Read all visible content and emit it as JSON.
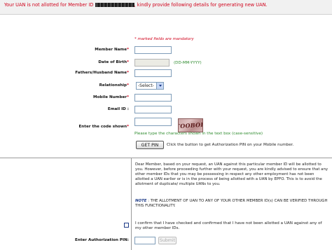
{
  "banner": {
    "text_before": "Your UAN is not allotted for Member ID ",
    "text_after": ", kindly provide following details for generating new UAN."
  },
  "form": {
    "mandatory_note": "* marked fields are mandatory",
    "member_name_label": "Member Name",
    "dob_label": "Date of Birth",
    "dob_format": "(DD-MM-YYYY)",
    "father_husband_label": "Fathers/Husband Name",
    "relationship_label": "Relationship",
    "relationship_value": "-Select-",
    "mobile_label": "Mobile Number",
    "email_label": "Email ID",
    "code_label": "Enter the code shown",
    "captcha_text": "TOOBOD",
    "captcha_hint": "Please type the characters shown in the text box (case-sensitive)",
    "get_pin_label": "GET PIN",
    "get_pin_hint": "Click the button to get Authorization PIN on your Mobile number."
  },
  "info": {
    "paragraph": "Dear Member, based on your request, an UAN against this particular member ID will be allotted to you. However, before proceeding further with your request, you are kindly advised to ensure that any other member IDs that you may be possessing in respect any other employment has not been allotted a UAN earlier or is in the process of being allotted with a UAN by EPFO. This is to avoid the allotment of duplicate/ multiple UANs to you.",
    "note_label": "NOTE",
    "note_text": " : THE ALLOTMENT OF UAN TO ANY OF YOUR OTHER MEMBER ID(s) CAN BE VERIFIED THROUGH THIS FUNCTIONALITY.",
    "confirm_text": "I confirm that I have checked and confirmed that I have not been allotted a UAN against any of my other member IDs."
  },
  "auth": {
    "pin_label": "Enter Authorization PIN:",
    "submit_label": "Submit"
  },
  "colors": {
    "required_star": "#d0021b",
    "hint": "#2e8b2e",
    "banner_text": "#d0021b"
  }
}
